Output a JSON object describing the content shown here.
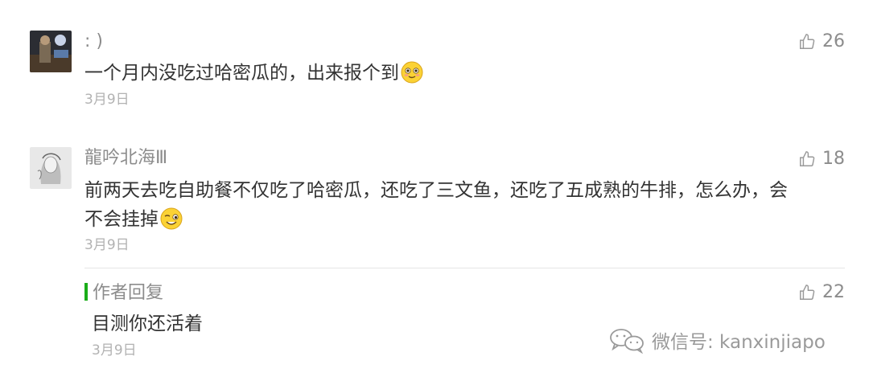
{
  "comments": [
    {
      "nickname": ": )",
      "content": "一个月内没吃过哈密瓜的，出来报个到",
      "date": "3月9日",
      "likes": "26",
      "emoji": "smile-blush-emoji"
    },
    {
      "nickname": "龍吟北海Ⅲ",
      "content_line1": "前两天去吃自助餐不仅吃了哈密瓜，还吃了三文鱼，还吃了五成熟的牛排，怎么办，会",
      "content_line2": "不会挂掉",
      "date": "3月9日",
      "likes": "18",
      "emoji": "wink-emoji"
    }
  ],
  "author_reply": {
    "label": "作者回复",
    "content": "目测你还活着",
    "date": "3月9日",
    "likes": "22"
  },
  "watermark": {
    "text": "微信号: kanxinjiapo",
    "icon": "wechat-icon"
  },
  "colors": {
    "text": "#333333",
    "muted": "#8c8c8c",
    "date": "#b2b2b2",
    "author_accent": "#1aad19"
  }
}
